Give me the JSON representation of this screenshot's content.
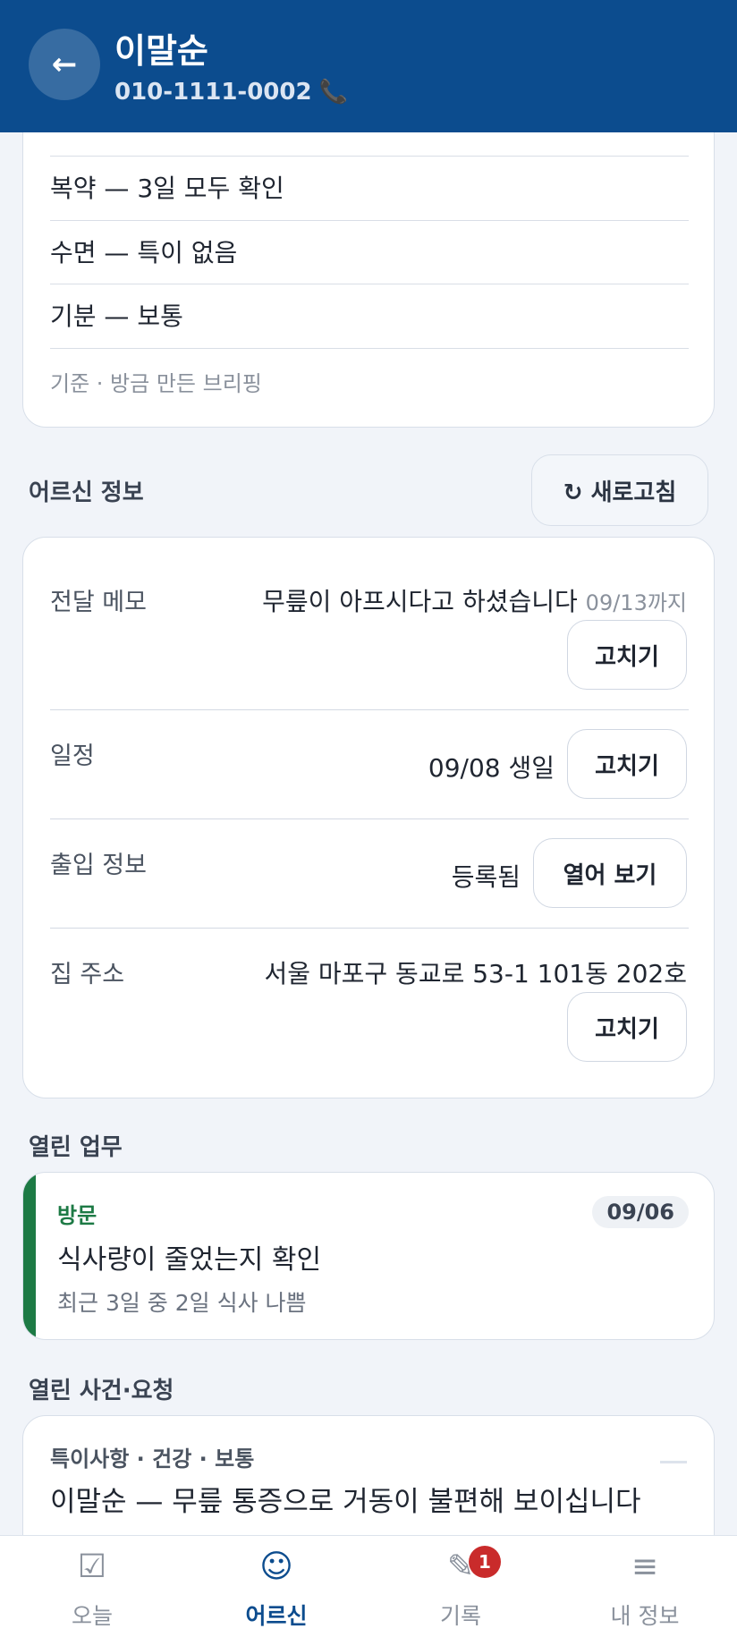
{
  "header": {
    "back_icon": "←",
    "name": "이말순",
    "phone": "010-1111-0002",
    "phone_icon": "📞"
  },
  "brief": {
    "rows": [
      "복약 — 3일 모두 확인",
      "수면 — 특이 없음",
      "기분 — 보통"
    ],
    "footer": "기준 · 방금 만든 브리핑"
  },
  "info_section": {
    "title": "어르신 정보",
    "refresh_label": "↻ 새로고침",
    "memo": {
      "label": "전달 메모",
      "value": "무릎이 아프시다고 하셨습니다",
      "until": "09/13까지",
      "button": "고치기"
    },
    "schedule": {
      "label": "일정",
      "value": "09/08 생일",
      "button": "고치기"
    },
    "access": {
      "label": "출입 정보",
      "value": "등록됨",
      "button": "열어 보기"
    },
    "address": {
      "label": "집 주소",
      "value": "서울 마포구 동교로 53-1 101동 202호",
      "button": "고치기"
    }
  },
  "tasks_section": {
    "title": "열린 업무",
    "task": {
      "category": "방문",
      "date": "09/06",
      "title": "식사량이 줄었는지 확인",
      "desc": "최근 3일 중 2일 식사 나쁨"
    }
  },
  "cases_section": {
    "title": "열린 사건·요청",
    "case": {
      "meta": "특이사항 · 건강 · 보통",
      "text": "이말순 — 무릎 통증으로 거동이 불편해 보이십니다"
    }
  },
  "nav": {
    "items": [
      {
        "icon": "☑",
        "label": "오늘"
      },
      {
        "icon": "☺",
        "label": "어르신"
      },
      {
        "icon": "✎",
        "label": "기록"
      },
      {
        "icon": "≡",
        "label": "내 정보"
      }
    ],
    "badge": "1"
  },
  "colors": {
    "header": "#0c4c8e",
    "accent_green": "#1d7a45",
    "badge_red": "#c92b2b"
  }
}
